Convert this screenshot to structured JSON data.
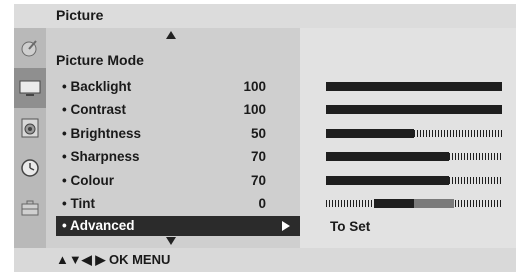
{
  "header": {
    "title": "Picture"
  },
  "sidebar": {
    "icons": [
      "satellite-dish-icon",
      "screen-icon",
      "speaker-icon",
      "clock-icon",
      "toolbox-icon"
    ],
    "active_index": 1
  },
  "menu": {
    "mode_label": "Picture Mode",
    "items": [
      {
        "label": "• Backlight",
        "value": "100",
        "level": 1.0
      },
      {
        "label": "• Contrast",
        "value": "100",
        "level": 1.0
      },
      {
        "label": "• Brightness",
        "value": "50",
        "level": 0.5
      },
      {
        "label": "• Sharpness",
        "value": "70",
        "level": 0.7
      },
      {
        "label": "• Colour",
        "value": "70",
        "level": 0.7
      },
      {
        "label": "• Tint",
        "value": "0",
        "level": 0.5
      }
    ],
    "advanced_label": "• Advanced",
    "advanced_hint": "To Set"
  },
  "footer": {
    "hint": "▲▼◀ ▶ OK  MENU"
  }
}
